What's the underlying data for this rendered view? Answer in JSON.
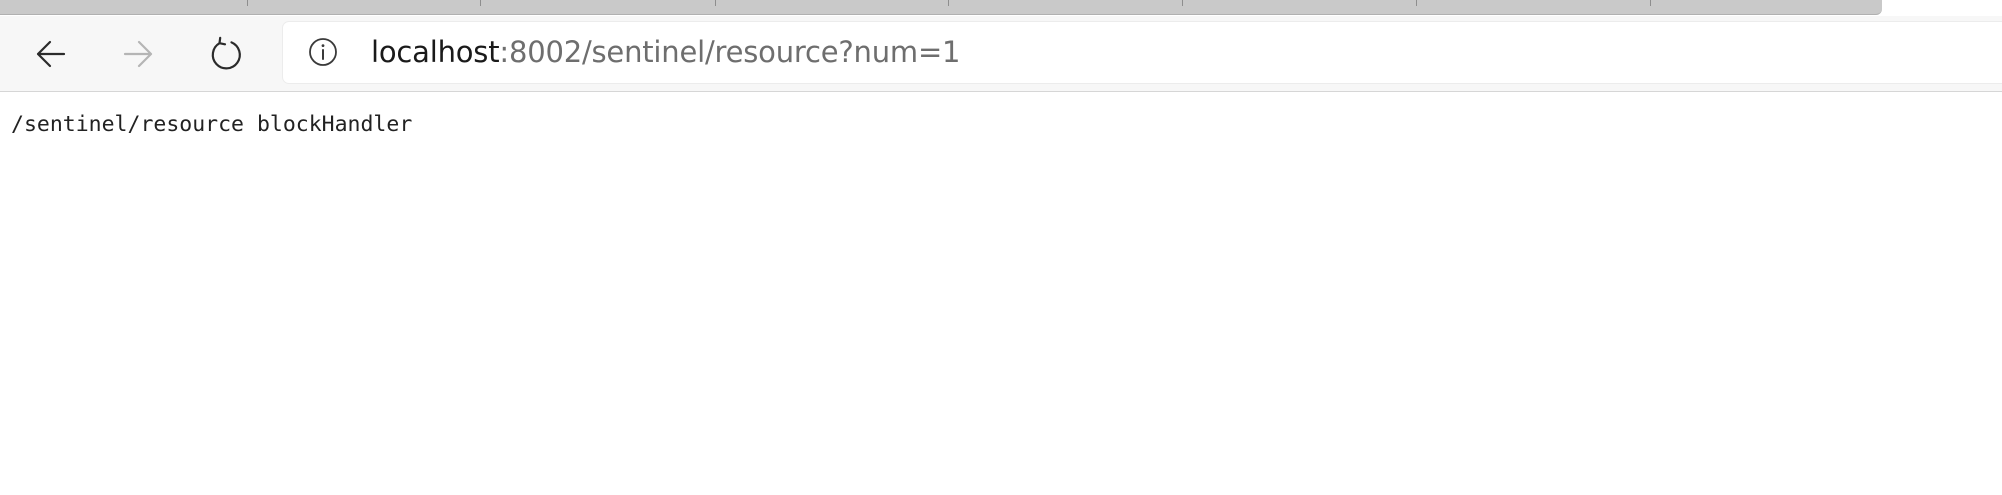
{
  "browser": {
    "nav": {
      "back_icon": "arrow-left-icon",
      "forward_icon": "arrow-right-icon",
      "reload_icon": "refresh-icon",
      "forward_enabled": false
    },
    "address_bar": {
      "info_icon": "info-circle-icon",
      "url_host": "localhost",
      "url_rest": ":8002/sentinel/resource?num=1"
    },
    "colors": {
      "toolbar_bg": "#f7f7f7",
      "tab_strip": "#c9c9c9",
      "url_host": "#1a1a1a",
      "url_rest": "#6e6e6e",
      "icon_active": "#2b2b2b",
      "icon_disabled": "#b5b5b5"
    }
  },
  "page": {
    "body_text": "/sentinel/resource blockHandler"
  }
}
